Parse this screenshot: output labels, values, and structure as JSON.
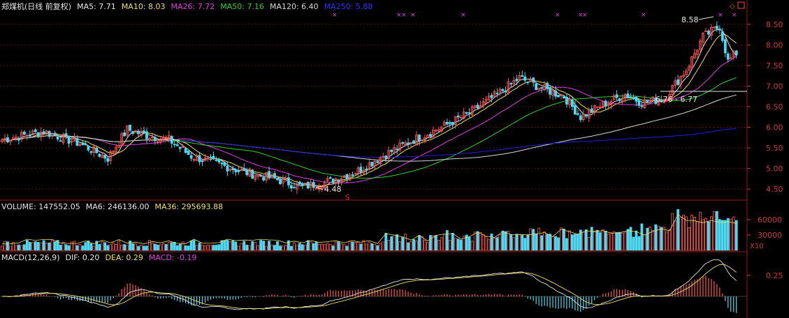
{
  "colors": {
    "bg": "#000000",
    "up": "#ff5555",
    "down": "#4fd8f0",
    "grid": "#5a1010",
    "frame": "#9b1d1d",
    "label": "#cccccc",
    "price_axis": "#cc3b3b",
    "ma5": "#e8e8e8",
    "ma10": "#f0e060",
    "ma26": "#e040e0",
    "ma50": "#30d030",
    "ma120": "#d8d8d8",
    "ma250": "#2020e0"
  },
  "header": {
    "name": "郑煤机(日线 前复权)",
    "items": [
      {
        "label": "MA5: 7.71",
        "color": "#e8e8e8"
      },
      {
        "label": "MA10: 8.03",
        "color": "#f0e060"
      },
      {
        "label": "MA26: 7.72",
        "color": "#e040e0"
      },
      {
        "label": "MA50: 7.16",
        "color": "#30d030"
      },
      {
        "label": "MA120: 6.40",
        "color": "#d8d8d8"
      },
      {
        "label": "MA250: 5.88",
        "color": "#3030ff"
      }
    ]
  },
  "volume_header": {
    "items": [
      {
        "label": "VOLUME: 147552.05",
        "color": "#e8e8e8"
      },
      {
        "label": "MA6: 246136.00",
        "color": "#e8e8e8"
      },
      {
        "label": "MA36: 295693.88",
        "color": "#f0e060"
      }
    ]
  },
  "macd_header": {
    "items": [
      {
        "label": "MACD(12,26,9)",
        "color": "#e8e8e8"
      },
      {
        "label": "DIF: 0.20",
        "color": "#e8e8e8"
      },
      {
        "label": "DEA: 0.29",
        "color": "#f0e060"
      },
      {
        "label": "MACD: -0.19",
        "color": "#e040e0"
      }
    ]
  },
  "annotations": {
    "high": "8.58",
    "low": "4.48",
    "range": "6.76 - 6.77",
    "marker": "S",
    "vol_unit": "X10"
  },
  "chart_data": [
    {
      "type": "candlestick",
      "title": "郑煤机(日线 前复权)",
      "ylim": [
        4.3,
        8.75
      ],
      "y_ticks": [
        "4.50",
        "5.00",
        "5.50",
        "6.00",
        "6.50",
        "7.00",
        "7.50",
        "8.00",
        "8.50"
      ],
      "close_anchors": [
        [
          0,
          5.7
        ],
        [
          15,
          5.9
        ],
        [
          28,
          5.6
        ],
        [
          38,
          5.25
        ],
        [
          45,
          5.95
        ],
        [
          52,
          5.8
        ],
        [
          60,
          5.7
        ],
        [
          68,
          5.3
        ],
        [
          78,
          5.1
        ],
        [
          88,
          4.9
        ],
        [
          98,
          4.75
        ],
        [
          108,
          4.55
        ],
        [
          118,
          4.7
        ],
        [
          128,
          4.95
        ],
        [
          138,
          5.35
        ],
        [
          148,
          5.7
        ],
        [
          158,
          6.0
        ],
        [
          168,
          6.35
        ],
        [
          178,
          6.8
        ],
        [
          186,
          7.2
        ],
        [
          194,
          6.95
        ],
        [
          202,
          6.75
        ],
        [
          208,
          6.25
        ],
        [
          216,
          6.55
        ],
        [
          224,
          6.8
        ],
        [
          230,
          6.6
        ],
        [
          238,
          6.7
        ],
        [
          246,
          7.4
        ],
        [
          252,
          8.2
        ],
        [
          258,
          8.45
        ],
        [
          261,
          7.6
        ],
        [
          264,
          7.8
        ]
      ],
      "ma_last": {
        "MA5": 7.71,
        "MA10": 8.03,
        "MA26": 7.72,
        "MA50": 7.16,
        "MA120": 6.4,
        "MA250": 5.88
      },
      "annotations": {
        "high": 8.58,
        "low": 4.48
      }
    },
    {
      "type": "bar",
      "title": "VOLUME",
      "y_ticks": [
        "30000",
        "60000"
      ],
      "ylim": [
        0,
        75000
      ]
    },
    {
      "type": "bar",
      "title": "MACD(12,26,9)",
      "y_ticks": [
        "0.25"
      ],
      "values": {
        "DIF": 0.2,
        "DEA": 0.29,
        "MACD": -0.19
      }
    }
  ]
}
